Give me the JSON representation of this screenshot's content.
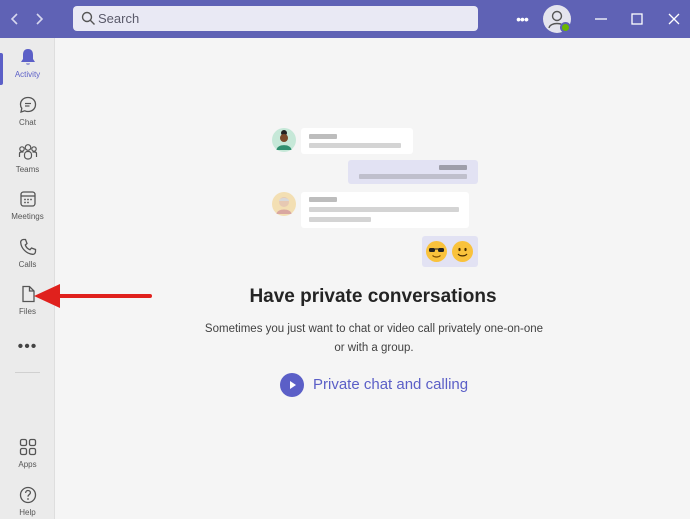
{
  "app": {
    "search_placeholder": "Search",
    "colors": {
      "accent": "#5b5fc7",
      "titlebar": "#5f62b5",
      "presence": "#6bb700",
      "annotation": "#e0211d"
    }
  },
  "sidebar": {
    "items": [
      {
        "label": "Activity",
        "icon": "bell-icon",
        "active": true
      },
      {
        "label": "Chat",
        "icon": "chat-icon"
      },
      {
        "label": "Teams",
        "icon": "teams-icon"
      },
      {
        "label": "Meetings",
        "icon": "calendar-icon"
      },
      {
        "label": "Calls",
        "icon": "phone-icon"
      },
      {
        "label": "Files",
        "icon": "file-icon"
      }
    ],
    "more_label": "•••",
    "bottom_items": [
      {
        "label": "Apps",
        "icon": "apps-icon"
      },
      {
        "label": "Help",
        "icon": "help-icon"
      }
    ]
  },
  "main": {
    "headline": "Have private conversations",
    "description": "Sometimes you just want to chat or video call privately one-on-one or with a group.",
    "cta_label": "Private chat and calling"
  }
}
